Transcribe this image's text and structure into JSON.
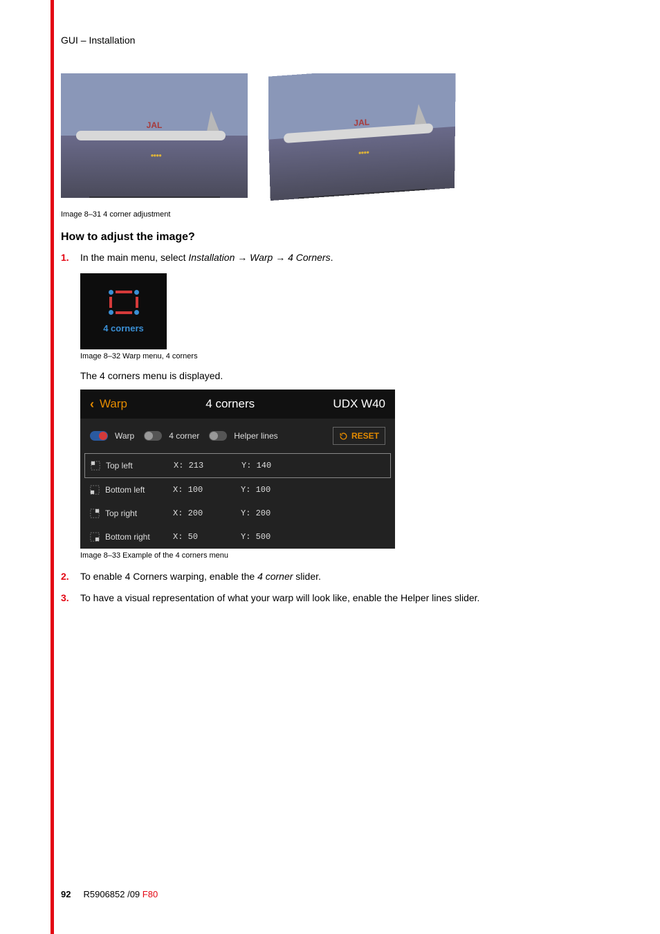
{
  "header": "GUI – Installation",
  "image8_31_caption": "Image 8–31  4 corner adjustment",
  "section_heading": "How to adjust the image?",
  "steps": {
    "s1_num": "1.",
    "s1_pre": "In the main menu, select ",
    "s1_path": "Installation → Warp → 4 Corners",
    "s1_post": ".",
    "s2_num": "2.",
    "s2_pre": "To enable 4 Corners warping, enable the ",
    "s2_em": "4 corner",
    "s2_post": " slider.",
    "s3_num": "3.",
    "s3_text": "To have a visual representation of what your warp will look like, enable the Helper lines slider."
  },
  "menu_tile_label": "4 corners",
  "image8_32_caption": "Image 8–32  Warp menu, 4 corners",
  "displayed_line": "The 4 corners menu is displayed.",
  "panel": {
    "back_glyph": "‹",
    "warp": "Warp",
    "title": "4 corners",
    "device": "UDX W40",
    "toggles": {
      "warp": "Warp",
      "fourcorner": "4 corner",
      "helper": "Helper lines"
    },
    "reset": "RESET",
    "rows": [
      {
        "name": "Top left",
        "x": "X:  213",
        "y": "Y:  140"
      },
      {
        "name": "Bottom left",
        "x": "X:  100",
        "y": "Y:  100"
      },
      {
        "name": "Top right",
        "x": "X:  200",
        "y": "Y:  200"
      },
      {
        "name": "Bottom right",
        "x": "X:  50",
        "y": "Y:  500"
      }
    ]
  },
  "image8_33_caption": "Image 8–33  Example of the 4 corners menu",
  "footer": {
    "page": "92",
    "code_black": "R5906852 /09",
    "code_red": "F80"
  },
  "plane_logo": "JAL"
}
